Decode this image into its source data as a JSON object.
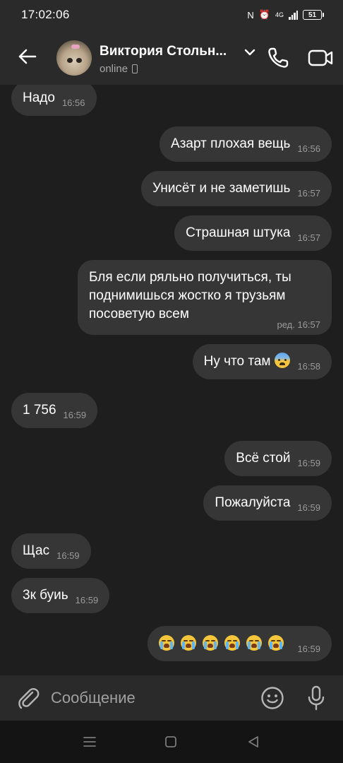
{
  "status_bar": {
    "time": "17:02:06",
    "network": "4G",
    "battery": "51"
  },
  "header": {
    "contact_name": "Виктория Стольн...",
    "contact_status": "online"
  },
  "messages": [
    {
      "side": "in",
      "text": "Надо",
      "time": "16:56"
    },
    {
      "side": "out",
      "text": "Азарт плохая вещь",
      "time": "16:56"
    },
    {
      "side": "out",
      "text": "Унисёт и не заметишь",
      "time": "16:57"
    },
    {
      "side": "out",
      "text": "Страшная штука",
      "time": "16:57"
    },
    {
      "side": "out",
      "text": "Бля если ряльно получиться, ты поднимишься жостко я трузьям посоветую всем",
      "time": "ред. 16:57"
    },
    {
      "side": "out",
      "text": "Ну что там",
      "emoji": "fearful-face",
      "time": "16:58"
    },
    {
      "side": "in",
      "text": "1 756",
      "time": "16:59"
    },
    {
      "side": "out",
      "text": "Всё стой",
      "time": "16:59"
    },
    {
      "side": "out",
      "text": "Пожалуйста",
      "time": "16:59"
    },
    {
      "side": "in",
      "text": "Щас",
      "time": "16:59"
    },
    {
      "side": "in",
      "text": "3к буиь",
      "time": "16:59"
    },
    {
      "side": "out",
      "emoji": "loudly-crying-face",
      "emoji_count": 6,
      "time": "16:59"
    }
  ],
  "composer": {
    "placeholder": "Сообщение"
  },
  "colors": {
    "background": "#1e1e1e",
    "bar": "#2a2a2a",
    "bubble": "#363636",
    "time_text": "#9a9a9a"
  }
}
